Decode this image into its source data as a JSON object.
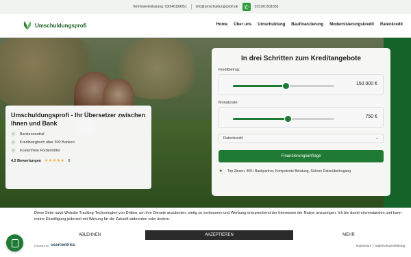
{
  "topbar": {
    "phone": "Terminvereinbarung: 030/46199951",
    "email": "info@umschuldungsprofi.de",
    "whatsapp": "0151/61931835"
  },
  "header": {
    "logo_text": "Umschuldungsprofi",
    "nav": [
      "Home",
      "Über uns",
      "Umschuldung",
      "Baufinanzierung",
      "Modernisierungskredit",
      "Ratenkredit"
    ]
  },
  "info_card": {
    "title": "Umschuldungsprofi - Ihr Übersetzer zwischen Ihnen und Bank",
    "checks": [
      "Bankenneutral",
      "Kreditvergleich über 300 Banken",
      "Kostenfreie Fördermittel"
    ],
    "rating_label": "4.2 Bewertungen",
    "stars": "★★★★★",
    "rating_count": "0"
  },
  "calculator": {
    "title": "In drei Schritten zum Kreditangebote",
    "amount_label": "Kreditbetrag:",
    "amount_value": "150.000 €",
    "amount_fraction": 0.52,
    "rate_label": "Monatsrate:",
    "rate_value": "750 €",
    "rate_fraction": 0.54,
    "select_value": "Ratenkredit",
    "cta_label": "Finanzierungsanfrage",
    "trust_text": "Top-Zinsen, 400+ Bankpartner, Kompetente Beratung, Sichere Datenübertragung"
  },
  "cookie": {
    "text": "Diese Seite nutzt Website Tracking-Technologien von Dritten, um ihre Dienste anzubieten, stetig zu verbessern und Werbung entsprechend der Interessen der Nutzer anzuzeigen. Ich bin damit einverstanden und kann meine Einwilligung jederzeit mit Wirkung für die Zukunft widerrufen oder ändern.",
    "reject_label": "ABLEHNEN",
    "accept_label": "AKZEPTIEREN",
    "more_label": "MEHR",
    "powered_by": "Powered by",
    "provider": "usercentrics",
    "imprint": "Impressum",
    "separator": "|",
    "privacy": "Datenschutzerklärung"
  },
  "colors": {
    "brand_green": "#1f7a34",
    "dark_button": "#2b2b2b"
  }
}
